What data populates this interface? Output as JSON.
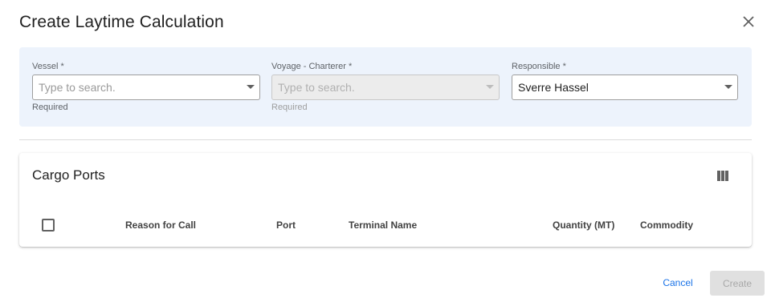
{
  "dialog": {
    "title": "Create Laytime Calculation",
    "close_icon": "close-icon"
  },
  "form": {
    "vessel": {
      "label": "Vessel *",
      "placeholder": "Type to search.",
      "value": "",
      "helper": "Required",
      "disabled": false
    },
    "voyage_charterer": {
      "label": "Voyage - Charterer *",
      "placeholder": "Type to search.",
      "value": "",
      "helper": "Required",
      "disabled": true
    },
    "responsible": {
      "label": "Responsible *",
      "value": "Sverre Hassel",
      "disabled": false
    }
  },
  "cargo_ports": {
    "title": "Cargo Ports",
    "columns_icon": "view-column-icon",
    "columns": [
      "Reason for Call",
      "Port",
      "Terminal Name",
      "Quantity (MT)",
      "Commodity"
    ],
    "select_all_checked": false
  },
  "actions": {
    "cancel_label": "Cancel",
    "create_label": "Create",
    "create_disabled": true
  },
  "colors": {
    "panel_bg": "#edf3fc",
    "link_blue": "#1a73e8",
    "disabled_bg": "#e0e0e0"
  }
}
